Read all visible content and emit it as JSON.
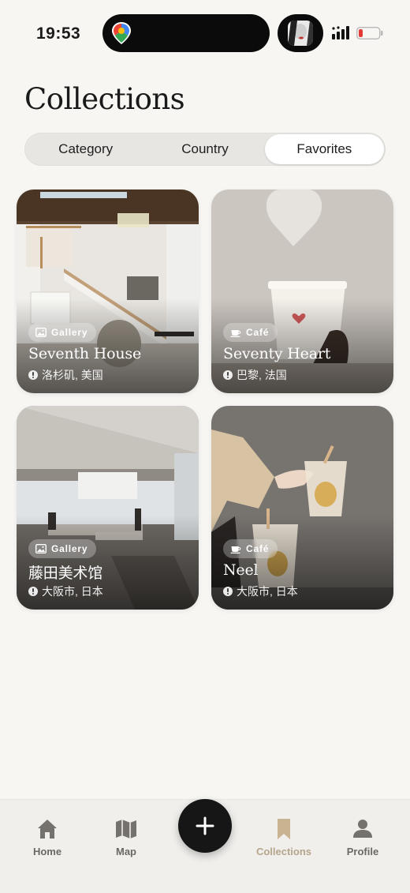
{
  "status": {
    "time": "19:53"
  },
  "header": {
    "title": "Collections"
  },
  "segments": [
    {
      "label": "Category",
      "active": false
    },
    {
      "label": "Country",
      "active": false
    },
    {
      "label": "Favorites",
      "active": true
    }
  ],
  "cards": [
    {
      "badge": "Gallery",
      "badge_icon": "photo-icon",
      "title": "Seventh House",
      "location": "洛杉矶, 美国"
    },
    {
      "badge": "Café",
      "badge_icon": "coffee-cup-icon",
      "title": "Seventy Heart",
      "location": "巴黎, 法国"
    },
    {
      "badge": "Gallery",
      "badge_icon": "photo-icon",
      "title": "藤田美术馆",
      "location": "大阪市, 日本"
    },
    {
      "badge": "Café",
      "badge_icon": "coffee-cup-icon",
      "title": "Neel",
      "location": "大阪市, 日本"
    }
  ],
  "tabbar": {
    "items": [
      {
        "label": "Home",
        "icon": "home-icon",
        "active": false
      },
      {
        "label": "Map",
        "icon": "map-icon",
        "active": false
      },
      {
        "label": "Collections",
        "icon": "bookmark-icon",
        "active": true
      },
      {
        "label": "Profile",
        "icon": "person-icon",
        "active": false
      }
    ],
    "fab_icon": "plus-icon"
  },
  "colors": {
    "accent": "#b5a58a",
    "background": "#f7f6f3",
    "fab": "#161616"
  }
}
